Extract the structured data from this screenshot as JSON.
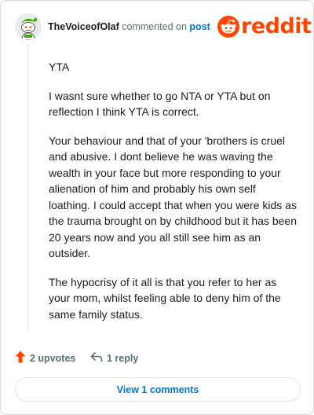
{
  "header": {
    "avatar_icon": "snoo-avatar-icon",
    "username": "TheVoiceofOlaf",
    "commented_text": "commented on",
    "post_link": "post",
    "brand_icon": "reddit-logo-icon",
    "brand_word": "reddit"
  },
  "comment": {
    "paragraphs": [
      "YTA",
      "I wasnt sure whether to go NTA or YTA but on reflection I think YTA is correct.",
      "Your behaviour and that of your 'brothers is cruel and abusive. I dont believe he was waving the wealth in your face but more responding to your alienation of him and probably his own self loathing. I could accept that when you were kids as the trauma brought on by childhood but it has been 20 years now and you all still see him as an outsider.",
      "The hypocrisy of it all is that you refer to her as your mom, whilst feeling able to deny him of the same family status."
    ]
  },
  "actions": {
    "upvote_icon": "upvote-arrow-icon",
    "upvotes_label": "2 upvotes",
    "reply_icon": "reply-arrow-icon",
    "reply_label": "1 reply"
  },
  "view_comments_label": "View 1 comments",
  "colors": {
    "brand": "#ff4500",
    "link": "#0079d3",
    "muted": "#576f76"
  }
}
